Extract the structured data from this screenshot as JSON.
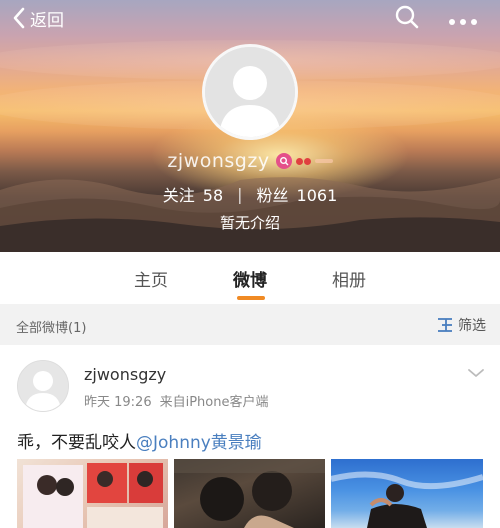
{
  "header": {
    "back_label": "返回",
    "username": "zjwonsgzy",
    "follow_label": "关注",
    "follow_count": "58",
    "fans_label": "粉丝",
    "fans_count": "1061",
    "intro": "暂无介绍",
    "icons": [
      "back-chevron-icon",
      "search-icon",
      "more-icon",
      "vip-icon",
      "level-icon"
    ]
  },
  "tabs": [
    {
      "label": "主页",
      "active": false
    },
    {
      "label": "微博",
      "active": true
    },
    {
      "label": "相册",
      "active": false
    }
  ],
  "filter": {
    "title": "全部微博(1)",
    "action": "筛选"
  },
  "post": {
    "username": "zjwonsgzy",
    "time": "昨天 19:26",
    "source": "来自iPhone客户端",
    "text": "乖，不要乱咬人",
    "mention": "@Johnny黄景瑜",
    "photos": [
      "photo-1",
      "photo-2",
      "photo-3"
    ]
  },
  "colors": {
    "accent": "#f08a24",
    "mention": "#4a7fbf",
    "vip": "#e4508a"
  }
}
